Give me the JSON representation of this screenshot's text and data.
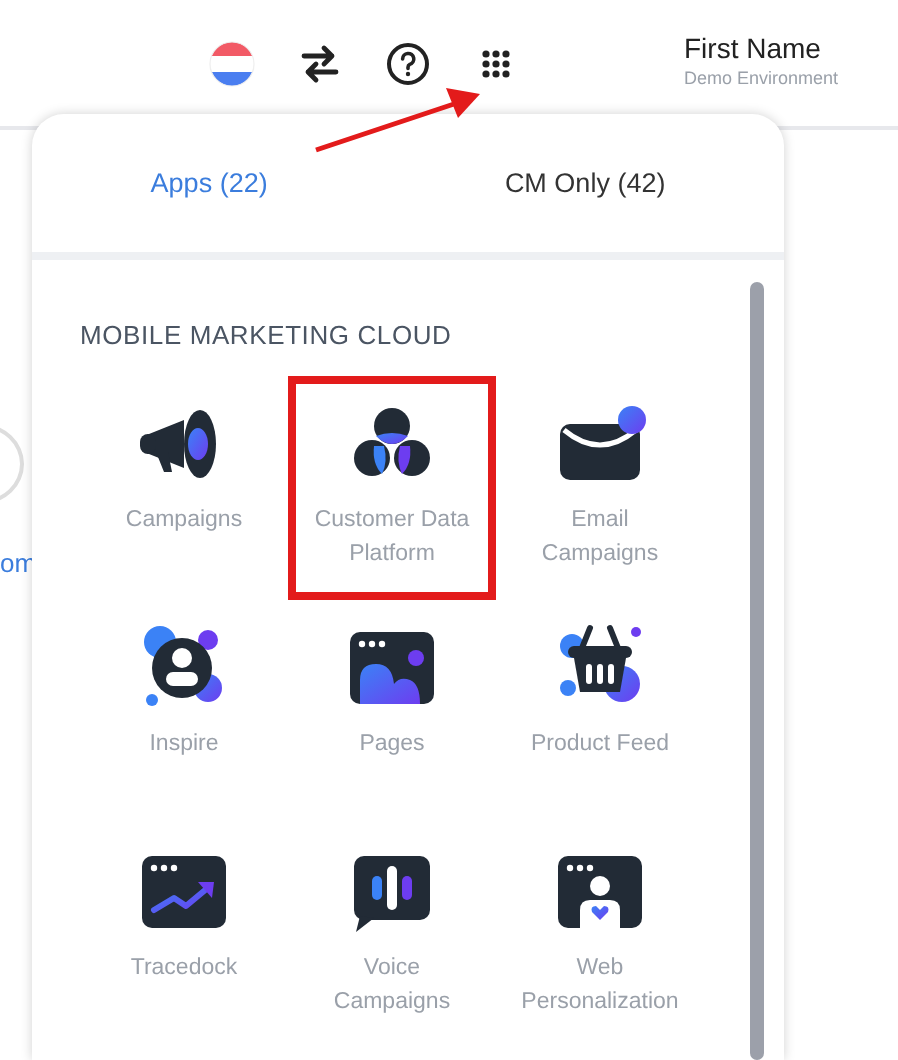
{
  "user": {
    "name": "First Name",
    "environment": "Demo Environment"
  },
  "background": {
    "link_fragment": "om"
  },
  "menu": {
    "tabs": [
      {
        "label": "Apps (22)",
        "selected": true
      },
      {
        "label": "CM Only (42)",
        "selected": false
      }
    ],
    "section": "MOBILE MARKETING CLOUD",
    "apps": [
      {
        "label": "Campaigns",
        "kind": "megaphone",
        "highlighted": false
      },
      {
        "label": "Customer Data Platform",
        "kind": "circles",
        "highlighted": true
      },
      {
        "label": "Email Campaigns",
        "kind": "envelope",
        "highlighted": false
      },
      {
        "label": "Inspire",
        "kind": "person",
        "highlighted": false
      },
      {
        "label": "Pages",
        "kind": "page",
        "highlighted": false
      },
      {
        "label": "Product Feed",
        "kind": "basket",
        "highlighted": false
      },
      {
        "label": "Tracedock",
        "kind": "trend",
        "highlighted": false
      },
      {
        "label": "Voice Campaigns",
        "kind": "voice",
        "highlighted": false
      },
      {
        "label": "Web Personalization",
        "kind": "webperson",
        "highlighted": false
      }
    ]
  }
}
